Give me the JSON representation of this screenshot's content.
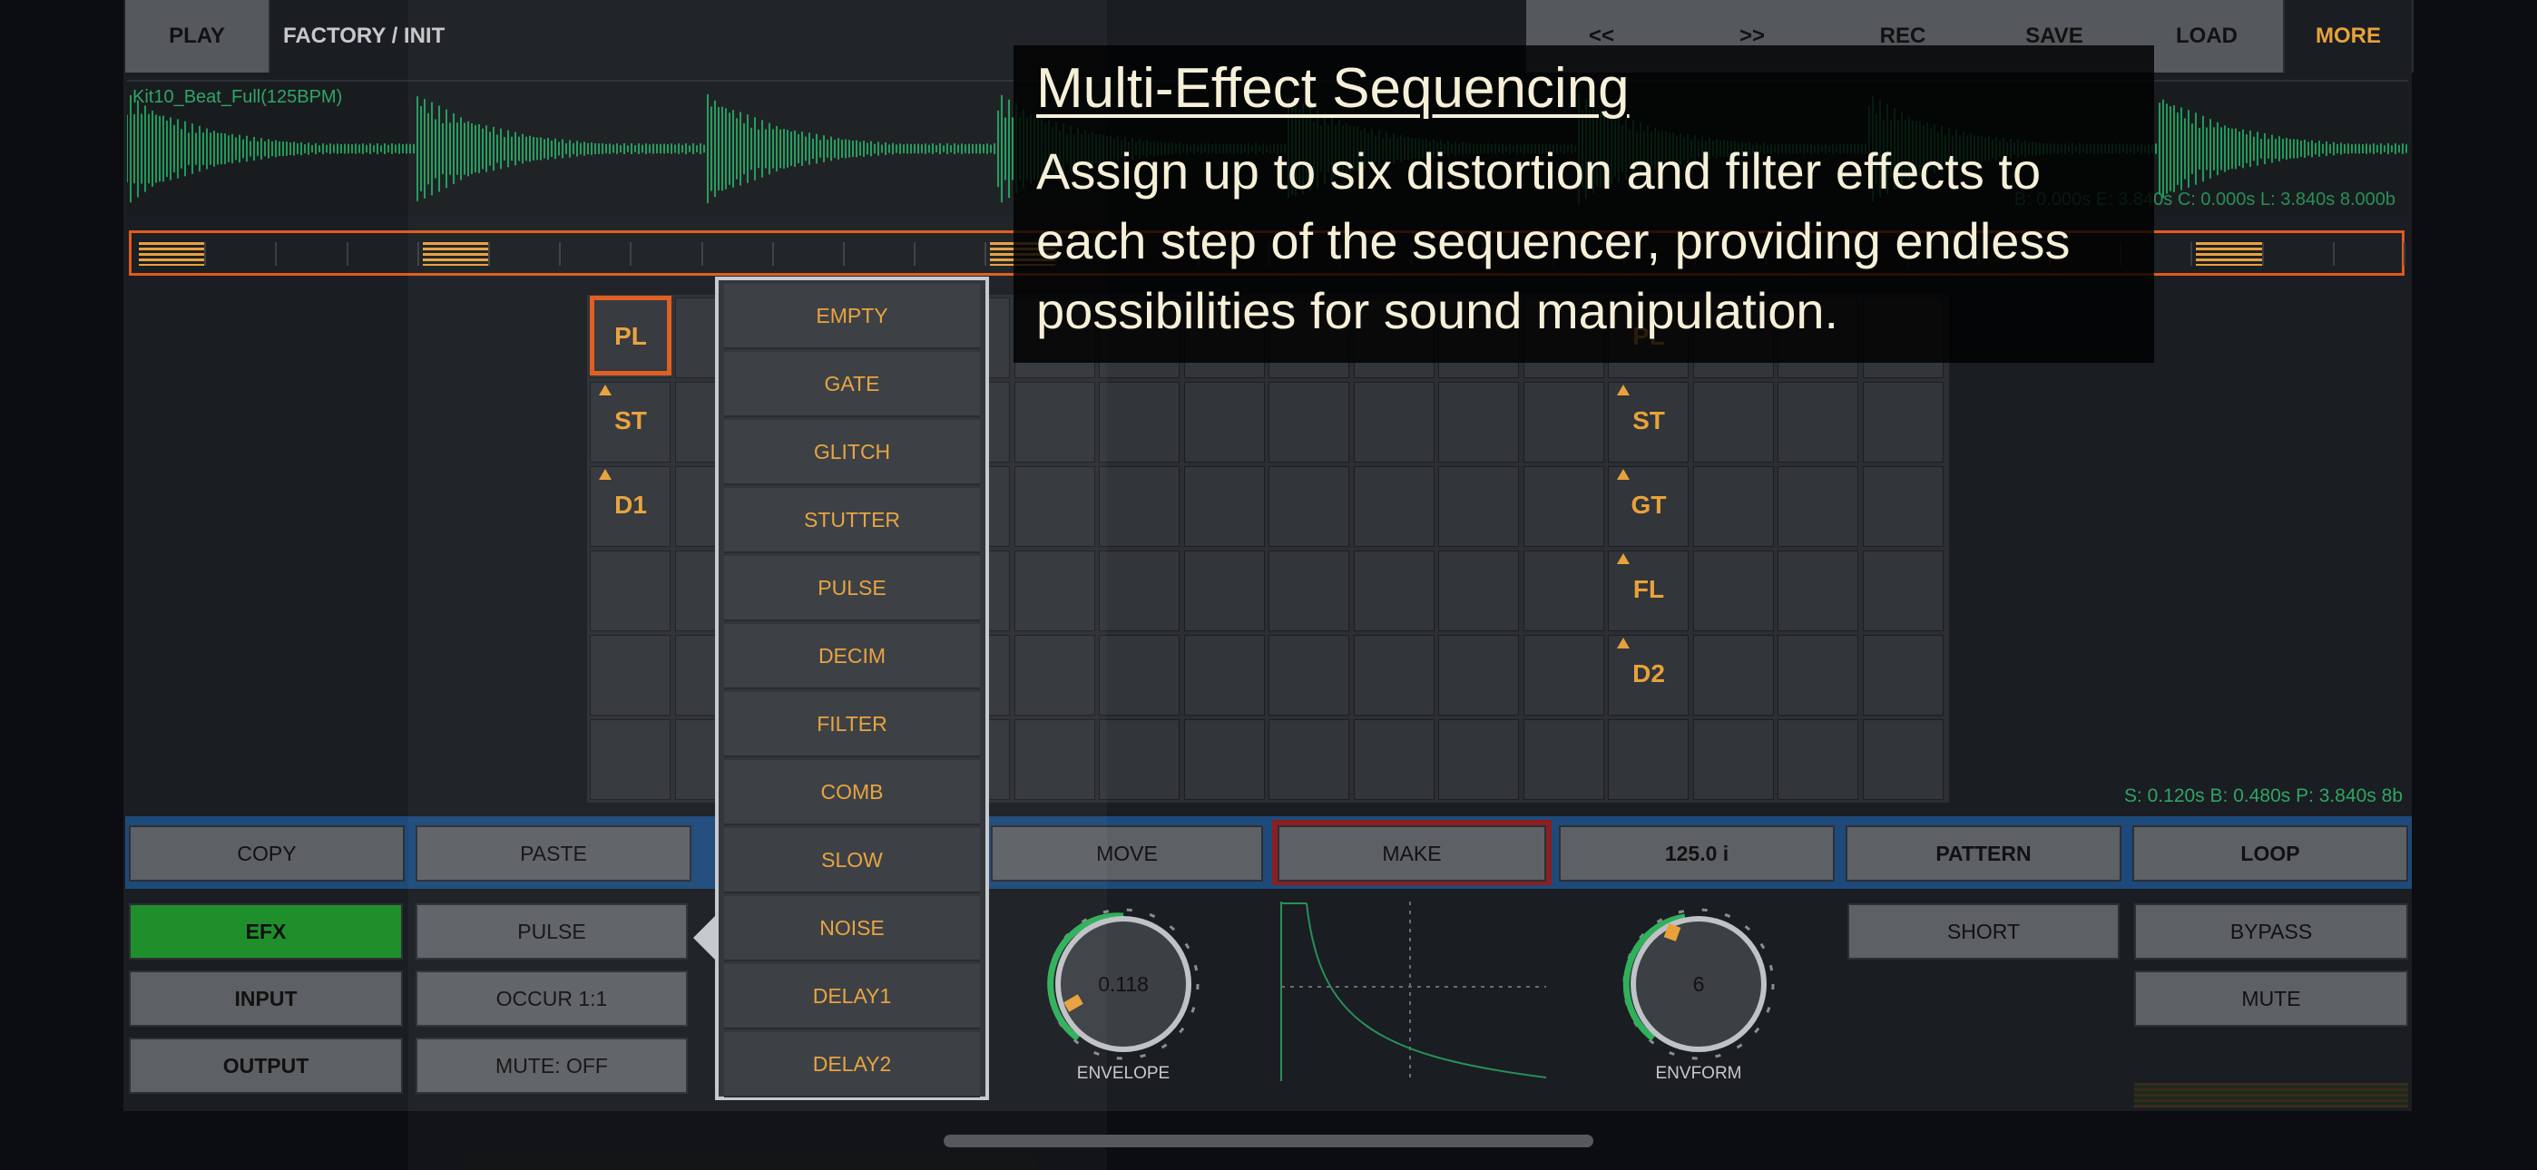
{
  "topbar": {
    "play": "PLAY",
    "preset": "FACTORY / INIT",
    "rewind": "<<",
    "forward": ">>",
    "rec": "REC",
    "save": "SAVE",
    "load": "LOAD",
    "more": "MORE"
  },
  "waveform": {
    "filename": "Kit10_Beat_Full(125BPM)",
    "info": "B: 0.000s E: 3.840s C: 0.000s L: 3.840s 8.000b"
  },
  "grid": {
    "left_labels": [
      "PL",
      "ST",
      "D1"
    ],
    "right_labels": [
      "PL",
      "ST",
      "GT",
      "FL",
      "D2"
    ]
  },
  "menu": {
    "items": [
      "EMPTY",
      "GATE",
      "GLITCH",
      "STUTTER",
      "PULSE",
      "DECIM",
      "FILTER",
      "COMB",
      "SLOW",
      "NOISE",
      "DELAY1",
      "DELAY2"
    ]
  },
  "status": "S: 0.120s B: 0.480s P: 3.840s 8b",
  "editrow": {
    "copy": "COPY",
    "paste": "PASTE",
    "move": "MOVE",
    "make": "MAKE",
    "tempo": "125.0 i",
    "pattern": "PATTERN",
    "loop": "LOOP"
  },
  "panel": {
    "efx": "EFX",
    "input": "INPUT",
    "output": "OUTPUT",
    "pulse": "PULSE",
    "occur": "OCCUR 1:1",
    "mute_off": "MUTE: OFF",
    "short": "SHORT",
    "bypass": "BYPASS",
    "mute": "MUTE",
    "envelope_value": "0.118",
    "envelope_label": "ENVELOPE",
    "envform_value": "6",
    "envform_label": "ENVFORM"
  },
  "overlay": {
    "title": "Multi-Effect Sequencing",
    "body": "Assign up to six distortion and filter effects to each step of the sequencer, providing endless possibilities for sound manipulation."
  },
  "colors": {
    "accent": "#e8a23a",
    "selection": "#e05a1b",
    "active_green": "#1f8f2b",
    "waveform": "#1f9a5a"
  }
}
